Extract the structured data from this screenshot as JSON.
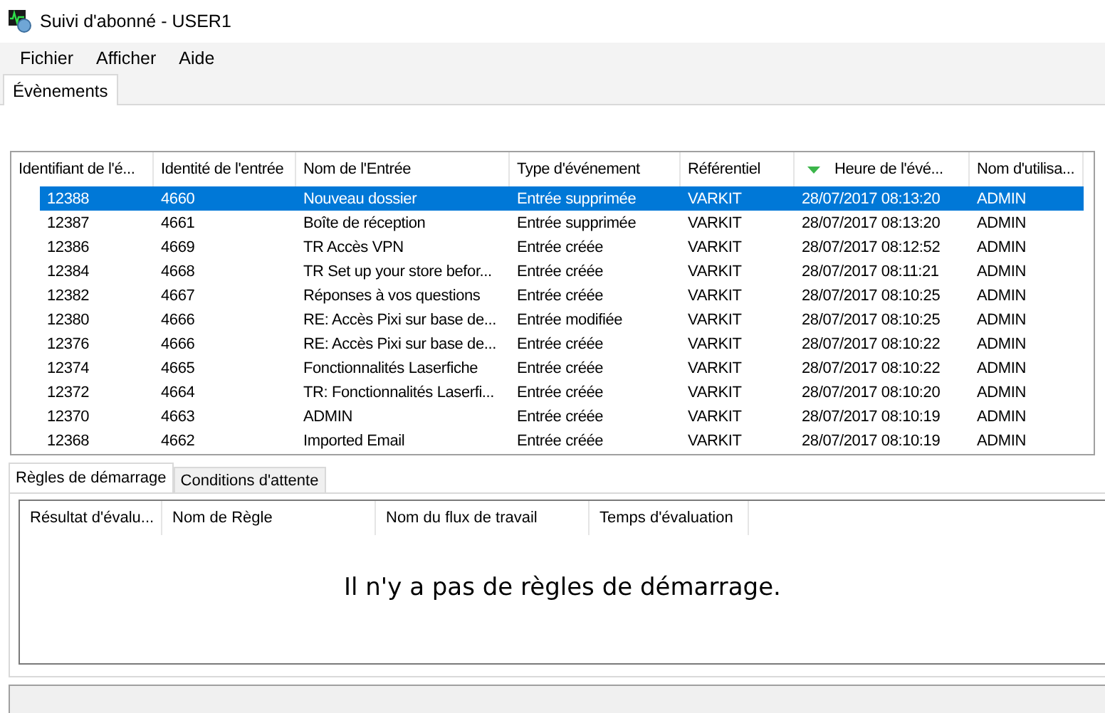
{
  "window": {
    "title": "Suivi d'abonné - USER1"
  },
  "menu": [
    "Fichier",
    "Afficher",
    "Aide"
  ],
  "tabs": [
    {
      "label": "Évènements",
      "selected": true
    }
  ],
  "events": {
    "columns": [
      {
        "label": "Identifiant de l'é..."
      },
      {
        "label": "Identité de l'entrée"
      },
      {
        "label": "Nom de l'Entrée"
      },
      {
        "label": "Type d'événement"
      },
      {
        "label": "Référentiel"
      },
      {
        "label": "Heure de l'évé...",
        "sorted": true
      },
      {
        "label": "Nom d'utilisa..."
      }
    ],
    "rows": [
      {
        "selected": true,
        "cells": [
          "12388",
          "4660",
          "Nouveau dossier",
          "Entrée supprimée",
          "VARKIT",
          "28/07/2017 08:13:20",
          "ADMIN"
        ]
      },
      {
        "selected": false,
        "cells": [
          "12387",
          "4661",
          "Boîte de réception",
          "Entrée supprimée",
          "VARKIT",
          "28/07/2017 08:13:20",
          "ADMIN"
        ]
      },
      {
        "selected": false,
        "cells": [
          "12386",
          "4669",
          "TR  Accès VPN",
          "Entrée créée",
          "VARKIT",
          "28/07/2017 08:12:52",
          "ADMIN"
        ]
      },
      {
        "selected": false,
        "cells": [
          "12384",
          "4668",
          "TR  Set up your store befor...",
          "Entrée créée",
          "VARKIT",
          "28/07/2017 08:11:21",
          "ADMIN"
        ]
      },
      {
        "selected": false,
        "cells": [
          "12382",
          "4667",
          "Réponses à vos questions",
          "Entrée créée",
          "VARKIT",
          "28/07/2017 08:10:25",
          "ADMIN"
        ]
      },
      {
        "selected": false,
        "cells": [
          "12380",
          "4666",
          "RE: Accès Pixi sur base de...",
          "Entrée modifiée",
          "VARKIT",
          "28/07/2017 08:10:25",
          "ADMIN"
        ]
      },
      {
        "selected": false,
        "cells": [
          "12376",
          "4666",
          "RE: Accès Pixi sur base de...",
          "Entrée créée",
          "VARKIT",
          "28/07/2017 08:10:22",
          "ADMIN"
        ]
      },
      {
        "selected": false,
        "cells": [
          "12374",
          "4665",
          "Fonctionnalités Laserfiche",
          "Entrée créée",
          "VARKIT",
          "28/07/2017 08:10:22",
          "ADMIN"
        ]
      },
      {
        "selected": false,
        "cells": [
          "12372",
          "4664",
          "TR: Fonctionnalités Laserfi...",
          "Entrée créée",
          "VARKIT",
          "28/07/2017 08:10:20",
          "ADMIN"
        ]
      },
      {
        "selected": false,
        "cells": [
          "12370",
          "4663",
          "ADMIN",
          "Entrée créée",
          "VARKIT",
          "28/07/2017 08:10:19",
          "ADMIN"
        ]
      },
      {
        "selected": false,
        "cells": [
          "12368",
          "4662",
          "Imported Email",
          "Entrée créée",
          "VARKIT",
          "28/07/2017 08:10:19",
          "ADMIN"
        ]
      }
    ]
  },
  "detail_tabs": [
    {
      "label": "Règles de démarrage",
      "selected": true
    },
    {
      "label": "Conditions d'attente",
      "selected": false
    }
  ],
  "rules": {
    "columns": [
      "Résultat d'évalu...",
      "Nom de Règle",
      "Nom du flux de travail",
      "Temps d'évaluation"
    ],
    "empty_message": "Il n'y a pas de règles de démarrage."
  }
}
